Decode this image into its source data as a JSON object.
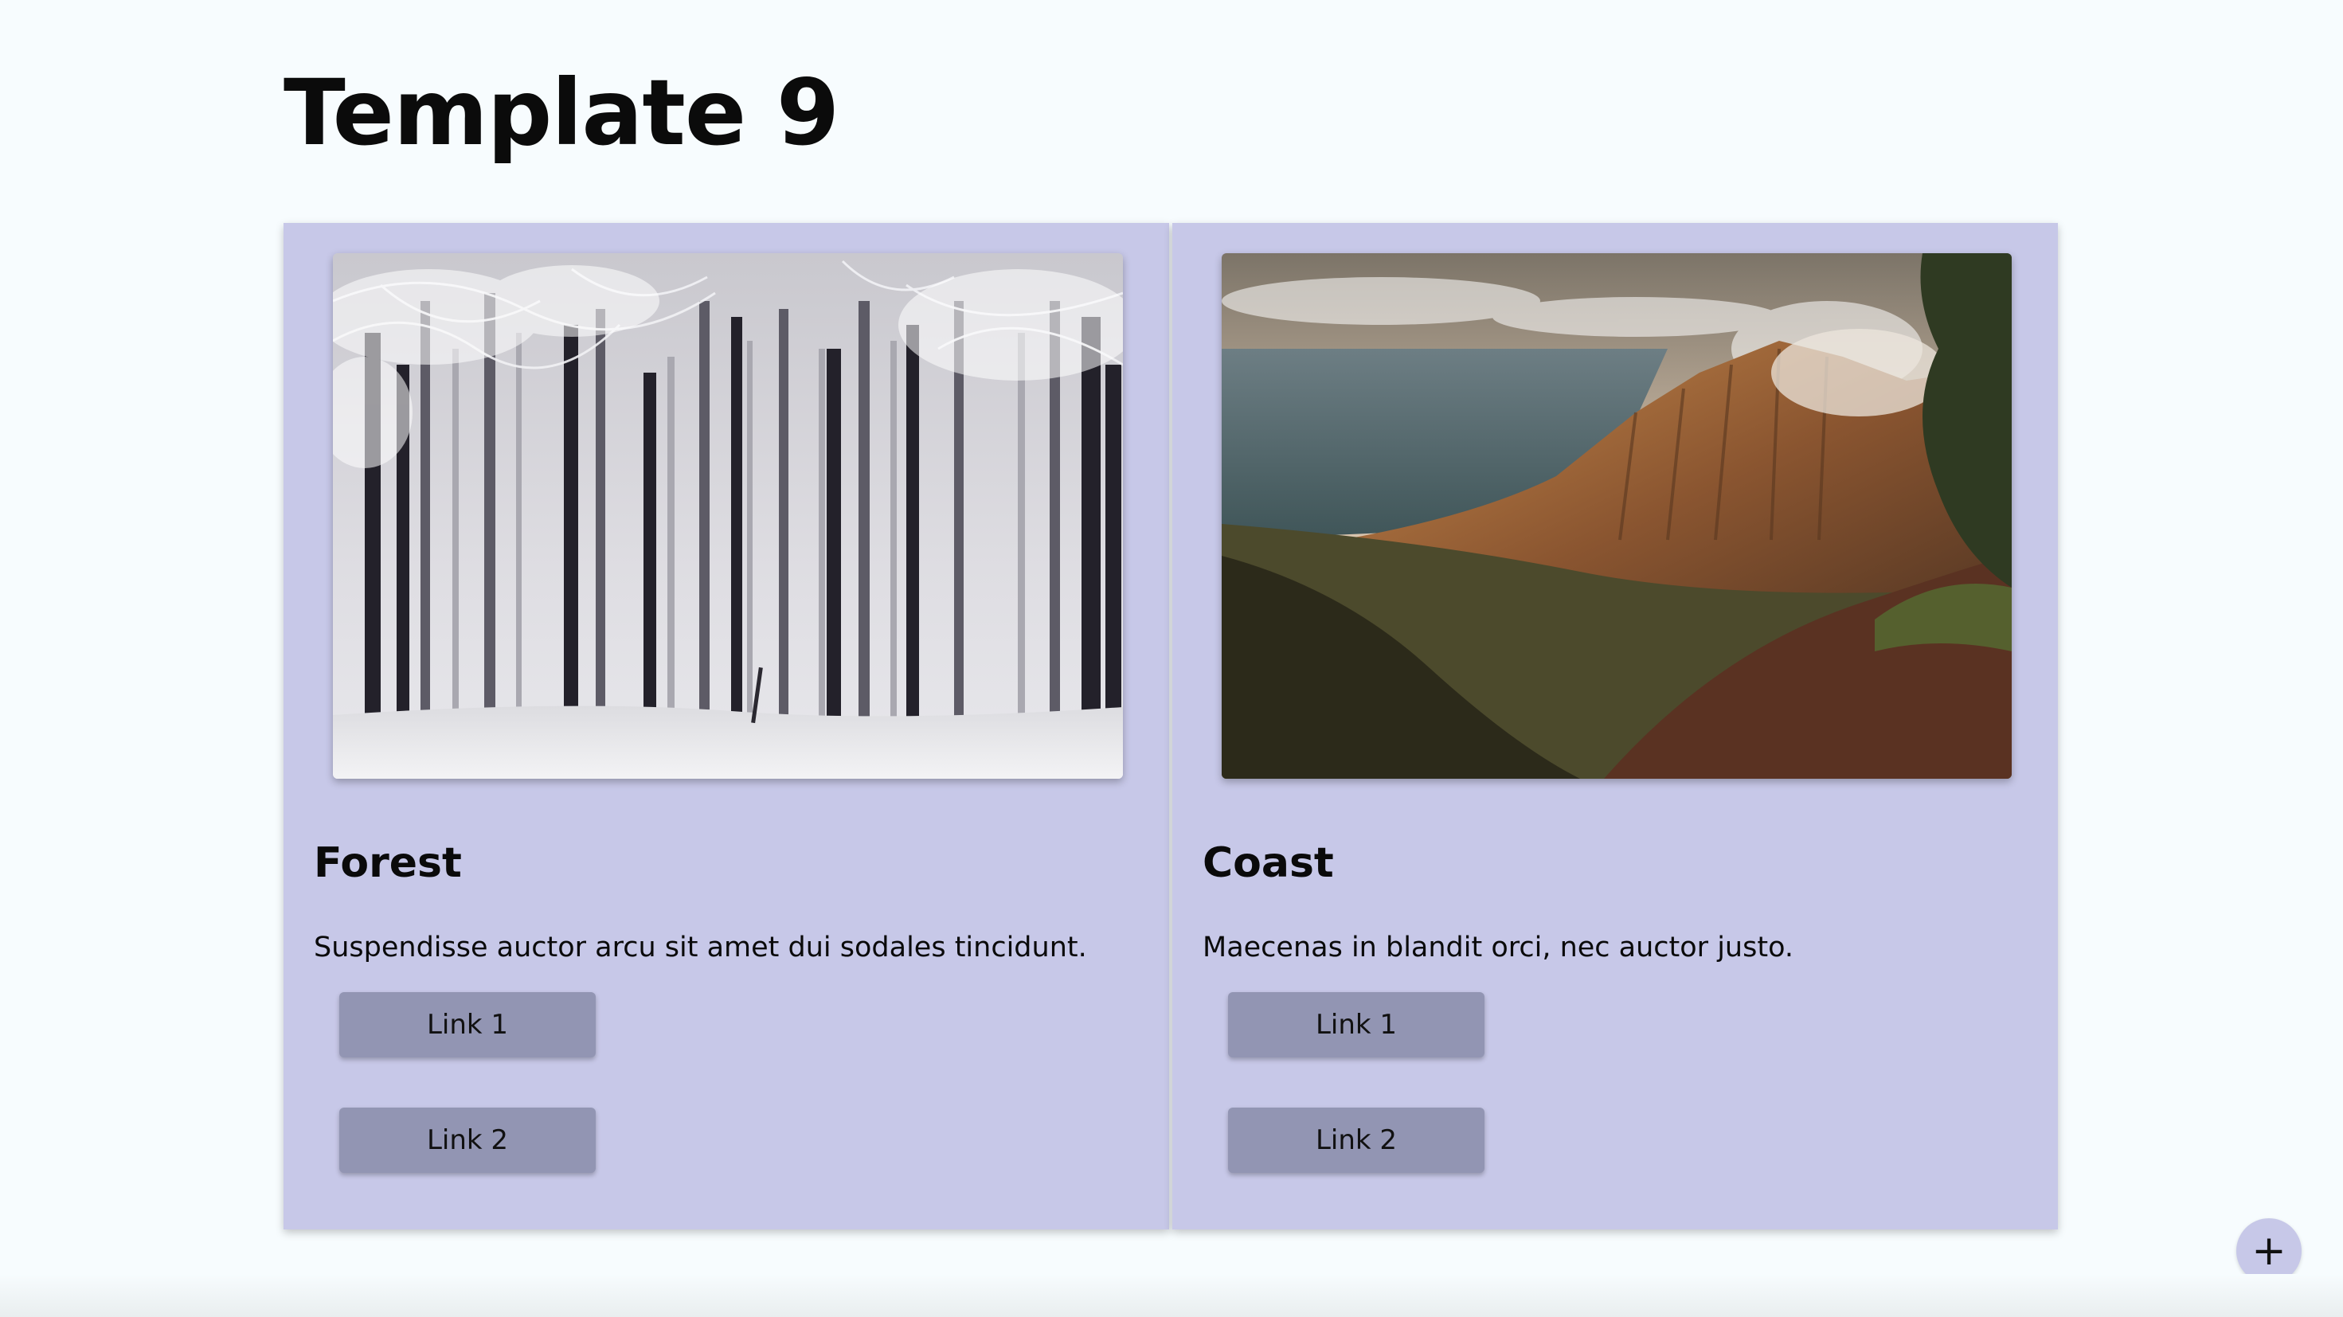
{
  "page": {
    "title": "Template 9"
  },
  "cards": [
    {
      "title": "Forest",
      "text": "Suspendisse auctor arcu sit amet dui sodales tincidunt.",
      "image_icon": "snowy-forest-photo",
      "link1": "Link 1",
      "link2": "Link 2"
    },
    {
      "title": "Coast",
      "text": "Maecenas in blandit orci, nec auctor justo.",
      "image_icon": "mountain-coast-photo",
      "link1": "Link 1",
      "link2": "Link 2"
    }
  ],
  "fab": {
    "symbol": "+"
  },
  "colors": {
    "background": "#f7fcfe",
    "card": "#c7c8e8",
    "button": "#9295b3"
  }
}
